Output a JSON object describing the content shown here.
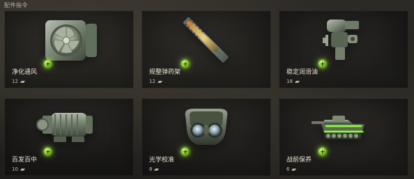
{
  "header": {
    "title": "配件指令"
  },
  "cards": [
    {
      "name": "净化通风",
      "count": "12",
      "icon": "ventilation-icon",
      "accent": "#8dcc2a"
    },
    {
      "name": "规整弹药架",
      "count": "12",
      "icon": "ammo-rack-icon",
      "accent": "#8dcc2a"
    },
    {
      "name": "稳定润滑油",
      "count": "18",
      "icon": "lubricant-icon",
      "accent": "#8dcc2a"
    },
    {
      "name": "百发百中",
      "count": "10",
      "icon": "motor-icon",
      "accent": "#8dcc2a"
    },
    {
      "name": "光学校准",
      "count": "8",
      "icon": "binocular-icon",
      "accent": "#8dcc2a"
    },
    {
      "name": "战前保养",
      "count": "6",
      "icon": "tank-icon",
      "accent": "#8dcc2a"
    }
  ],
  "colors": {
    "background": "#24221f",
    "card_border": "#3a3731",
    "add_glow": "#8dcc2a"
  }
}
